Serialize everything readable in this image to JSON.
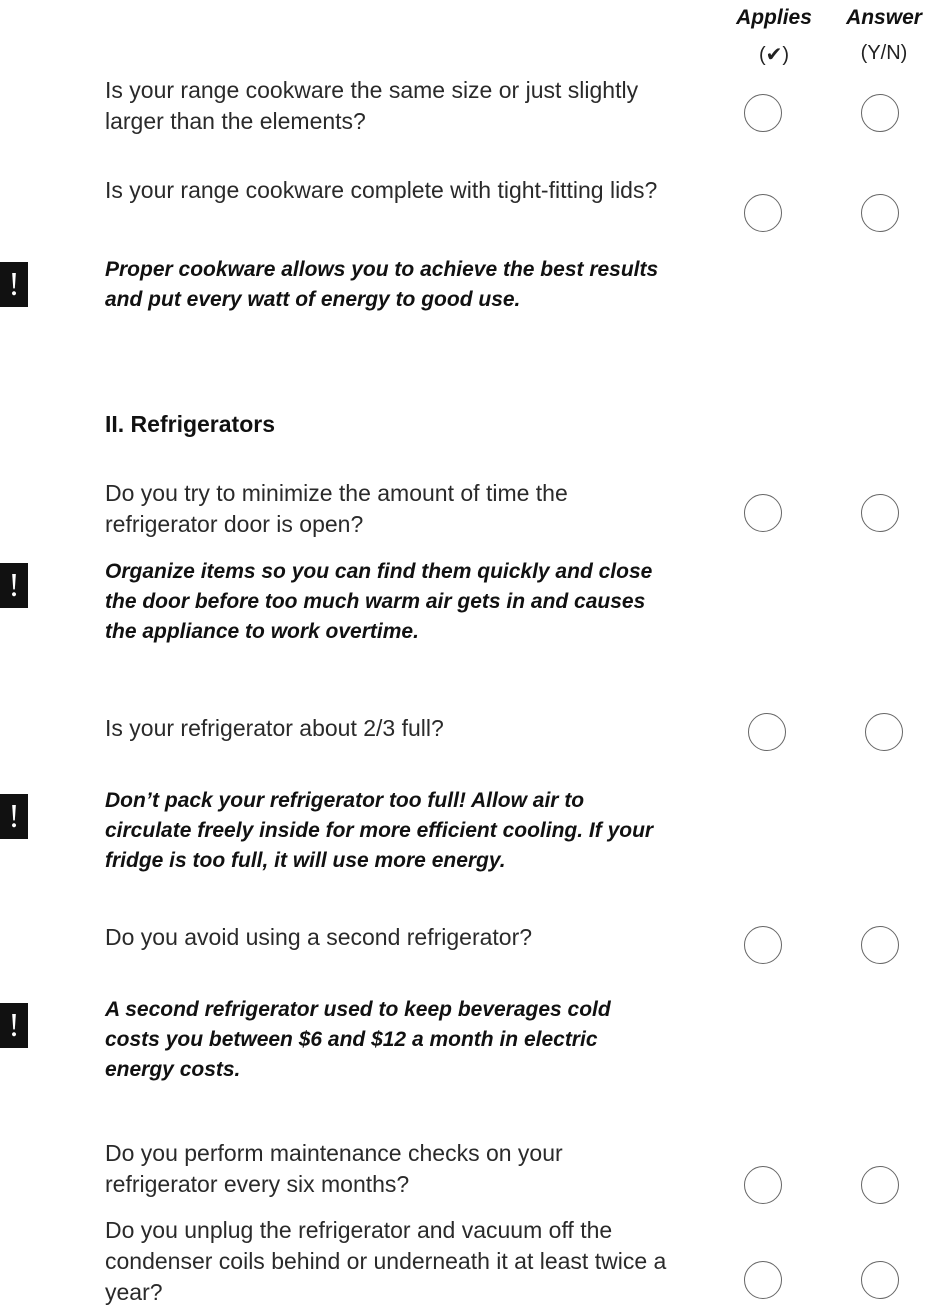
{
  "columns": {
    "applies_label": "Applies",
    "applies_sub": "(✔)",
    "answer_label": "Answer",
    "answer_sub": "(Y/N)"
  },
  "questions": [
    {
      "text": "Is your range cookware the same size or just slightly larger than the elements?"
    },
    {
      "text": "Is your range cookware complete with tight-fitting lids?"
    },
    {
      "text": "Do you try to minimize the amount of time the refrigerator door is open?"
    },
    {
      "text": "Is your refrigerator about 2/3 full?"
    },
    {
      "text": "Do you avoid using a second refrigerator?"
    },
    {
      "text": "Do you perform maintenance checks on your refrigerator every six months?"
    },
    {
      "text": "Do you unplug the refrigerator and vacuum off the condenser coils behind or underneath it at least twice a year?"
    }
  ],
  "notes": [
    {
      "icon": "!",
      "text": "Proper cookware allows you to achieve the best results and put every watt of energy to good use."
    },
    {
      "icon": "!",
      "text": "Organize items so you can find them quickly and close the door before too much warm air gets in and causes the appliance to work overtime."
    },
    {
      "icon": "!",
      "text": "Don’t pack your refrigerator too full! Allow air to circulate freely inside for more efficient cooling. If your fridge is too full, it will use more energy."
    },
    {
      "icon": "!",
      "text": "A second refrigerator used to keep beverages cold costs you between $6 and $12 a month in electric energy costs."
    }
  ],
  "section": {
    "heading": "II. Refrigerators"
  }
}
